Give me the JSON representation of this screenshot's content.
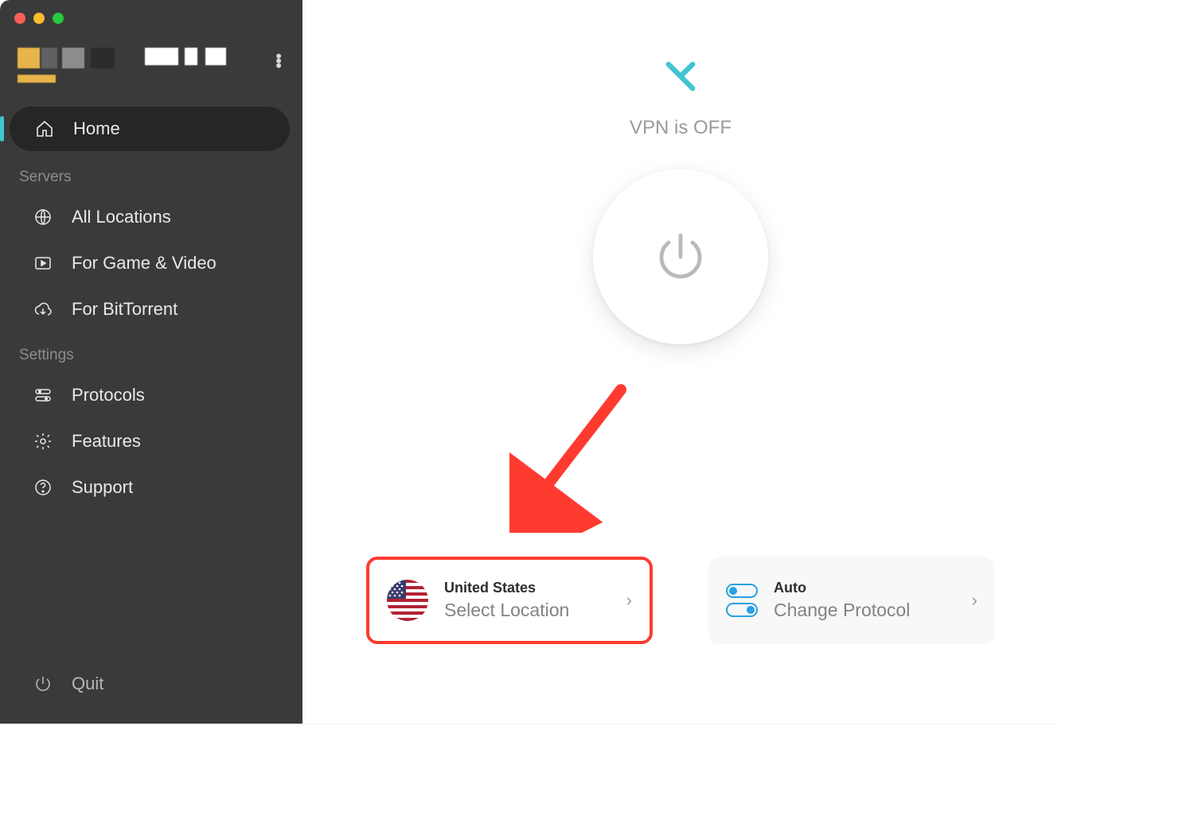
{
  "sidebar": {
    "nav": {
      "home": "Home",
      "section_servers": "Servers",
      "all_locations": "All Locations",
      "game_video": "For Game & Video",
      "bittorrent": "For BitTorrent",
      "section_settings": "Settings",
      "protocols": "Protocols",
      "features": "Features",
      "support": "Support",
      "quit": "Quit"
    }
  },
  "main": {
    "status": "VPN is OFF",
    "location_card": {
      "country": "United States",
      "action": "Select Location"
    },
    "protocol_card": {
      "mode": "Auto",
      "action": "Change Protocol"
    }
  }
}
